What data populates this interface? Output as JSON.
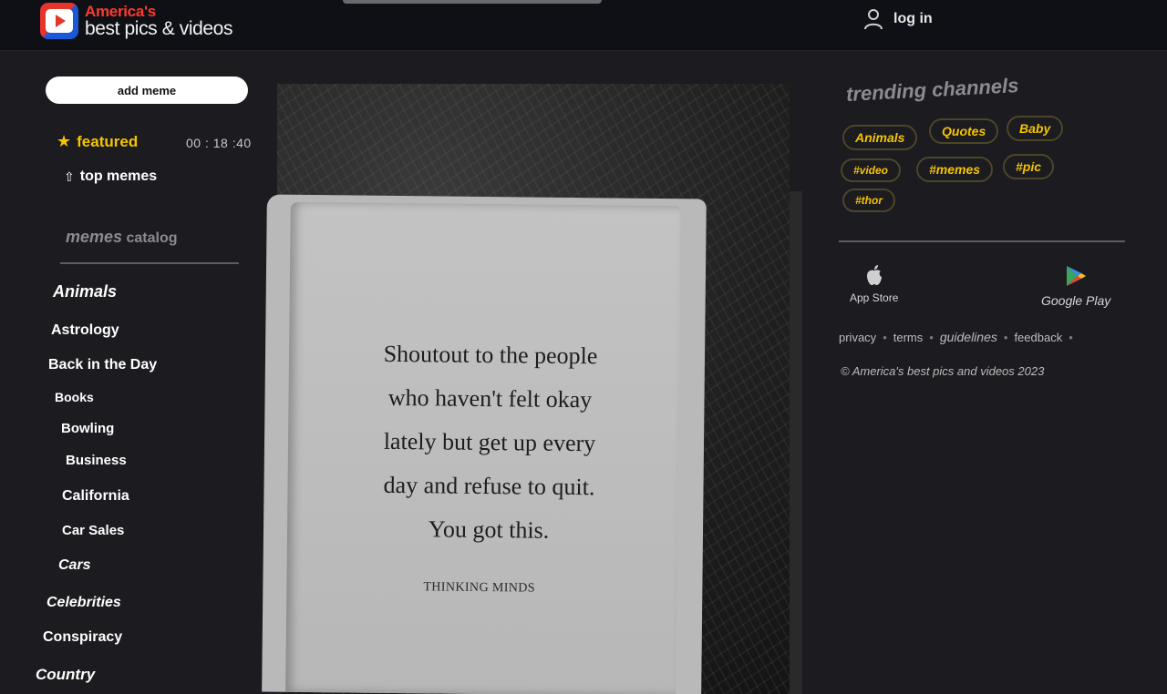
{
  "header": {
    "brand_line1": "America's",
    "brand_line2": "best pics & videos",
    "login_label": "log in"
  },
  "sidebar": {
    "add_button": "add meme",
    "featured_label": "featured",
    "featured_icon": "star-icon",
    "timer": "00 : 18 :40",
    "top_label": "top memes",
    "catalog_title_a": "memes",
    "catalog_title_b": "catalog",
    "categories": [
      "Animals",
      "Astrology",
      "Back in the Day",
      "Books",
      "Bowling",
      "Business",
      "California",
      "Car Sales",
      "Cars",
      "Celebrities",
      "Conspiracy",
      "Country"
    ]
  },
  "meme": {
    "quote": "Shoutout to the people\nwho haven't felt okay\nlately but get up every\nday and refuse to quit.\nYou got this.",
    "signature": "THINKING MINDS"
  },
  "right": {
    "trending_title": "trending channels",
    "chips": [
      "Animals",
      "Quotes",
      "Baby",
      "#video",
      "#memes",
      "#pic",
      "#thor"
    ],
    "app_store": "App Store",
    "google_play": "Google Play",
    "links": [
      "privacy",
      "terms",
      "guidelines",
      "feedback"
    ],
    "copyright": "© America's best pics and videos 2023"
  },
  "colors": {
    "accent": "#f5c400",
    "brand_red": "#ff3a2e",
    "brand_blue": "#1b58d8",
    "background": "#1b1b20",
    "header": "#0f1016"
  }
}
